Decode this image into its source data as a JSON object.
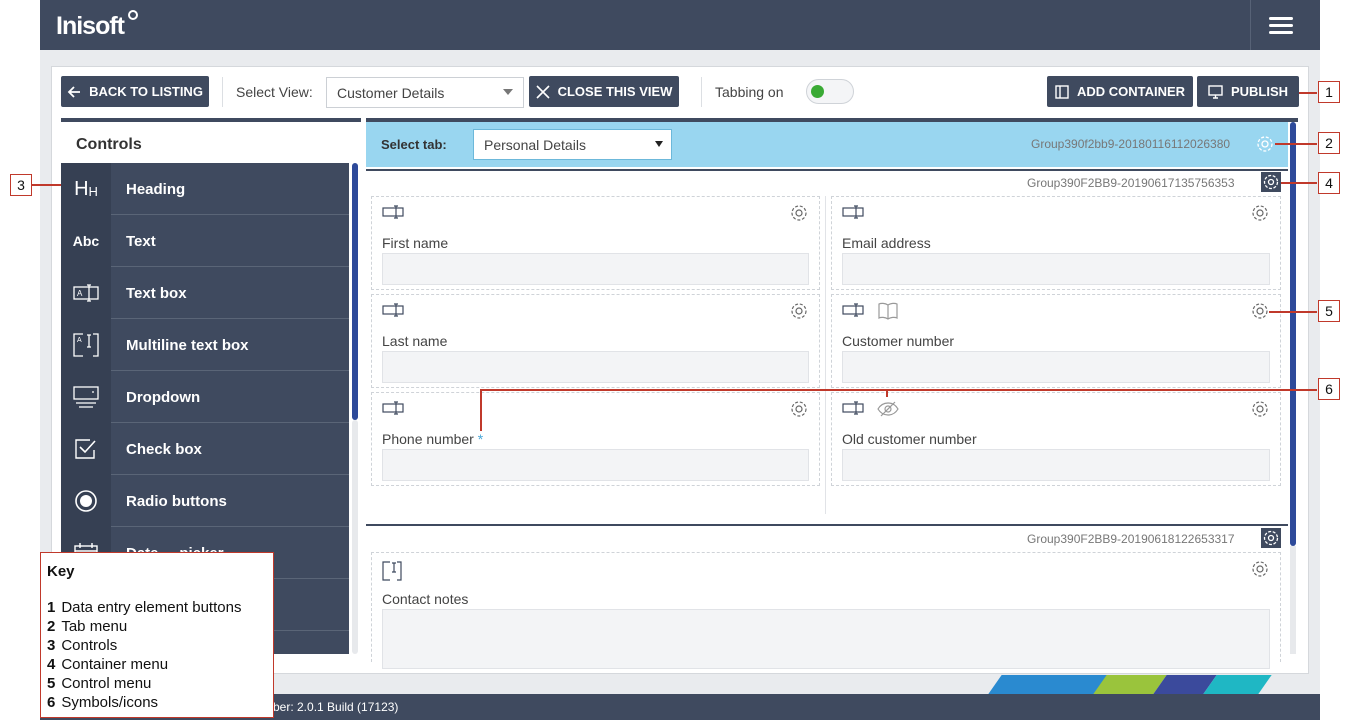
{
  "app": {
    "logo": "Inisoft"
  },
  "toolbar": {
    "back_label": "BACK TO LISTING",
    "select_view_label": "Select View:",
    "select_view_value": "Customer Details",
    "close_view_label": "CLOSE THIS VIEW",
    "tabbing_label": "Tabbing on",
    "tabbing_on": true,
    "add_container_label": "ADD CONTAINER",
    "publish_label": "PUBLISH"
  },
  "sidebar": {
    "title": "Controls",
    "items": [
      {
        "label": "Heading",
        "icon": "heading-icon",
        "glyph": "HH"
      },
      {
        "label": "Text",
        "icon": "text-icon",
        "glyph": "Abc"
      },
      {
        "label": "Text box",
        "icon": "textbox-icon"
      },
      {
        "label": "Multiline text box",
        "icon": "multiline-textbox-icon"
      },
      {
        "label": "Dropdown",
        "icon": "dropdown-icon"
      },
      {
        "label": "Check box",
        "icon": "checkbox-icon"
      },
      {
        "label": "Radio buttons",
        "icon": "radio-icon"
      },
      {
        "label": "Date ... picker",
        "icon": "calendar-icon"
      }
    ]
  },
  "tabbar": {
    "label": "Select tab:",
    "value": "Personal Details",
    "group_id": "Group390f2bb9-20180116112026380"
  },
  "containers": [
    {
      "group_id": "Group390F2BB9-20190617135756353",
      "fields": [
        {
          "label": "First name",
          "required": false
        },
        {
          "label": "Email address",
          "required": false
        },
        {
          "label": "Last name",
          "required": false
        },
        {
          "label": "Customer number",
          "required": false,
          "extra_icon": "book-icon"
        },
        {
          "label": "Phone number",
          "required": true,
          "required_mark": "*"
        },
        {
          "label": "Old customer number",
          "required": false,
          "extra_icon": "hidden-eye-icon"
        }
      ]
    },
    {
      "group_id": "Group390F2BB9-20190618122653317",
      "fields": [
        {
          "label": "Contact notes",
          "required": false
        }
      ]
    }
  ],
  "callouts": [
    "1",
    "2",
    "3",
    "4",
    "5",
    "6"
  ],
  "key": {
    "title": "Key",
    "items": [
      {
        "num": "1",
        "text": "Data entry element buttons"
      },
      {
        "num": "2",
        "text": "Tab menu"
      },
      {
        "num": "3",
        "text": "Controls"
      },
      {
        "num": "4",
        "text": "Container menu"
      },
      {
        "num": "5",
        "text": "Control menu"
      },
      {
        "num": "6",
        "text": "Symbols/icons"
      }
    ]
  },
  "footer": {
    "version_text": "ber: 2.0.1 Build (17123)"
  },
  "colors": {
    "nav": "#3f4a5f",
    "tabbar": "#99d6f0",
    "accent": "#2d4a9a",
    "callout": "#c0392b",
    "toggle_on": "#3aaa35"
  }
}
